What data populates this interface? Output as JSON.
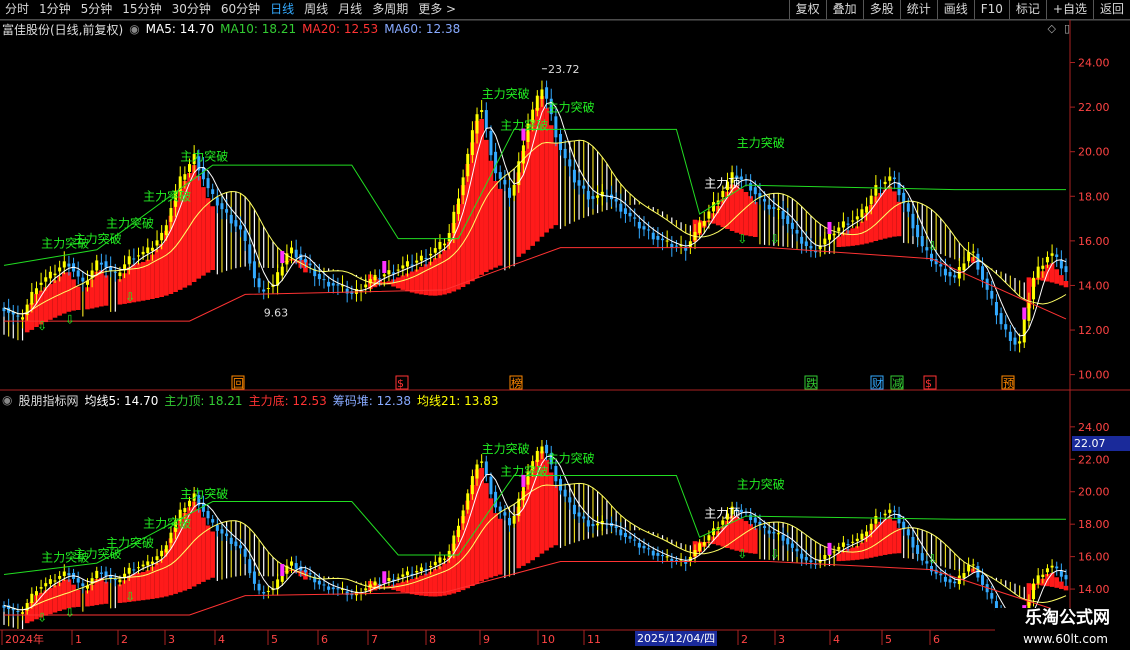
{
  "toolbar": {
    "periods": [
      "分时",
      "1分钟",
      "5分钟",
      "15分钟",
      "30分钟",
      "60分钟",
      "日线",
      "周线",
      "月线",
      "多周期",
      "更多"
    ],
    "active_period": "日线",
    "more_arrow": ">",
    "right_buttons": [
      "复权",
      "叠加",
      "多股",
      "统计",
      "画线",
      "F10",
      "标记",
      "+自选",
      "返回"
    ]
  },
  "main_panel": {
    "title": "富佳股份(日线,前复权)",
    "indicators": [
      {
        "label": "MA5: 14.70",
        "color": "#ffffff"
      },
      {
        "label": "MA10: 18.21",
        "color": "#33cc33"
      },
      {
        "label": "MA20: 12.53",
        "color": "#ff3333"
      },
      {
        "label": "MA60: 12.38",
        "color": "#88aaff"
      }
    ],
    "high_label": "23.72",
    "low_label": "9.63",
    "y_ticks": [
      "24.00",
      "22.00",
      "20.00",
      "18.00",
      "16.00",
      "14.00",
      "12.00",
      "10.00"
    ],
    "signals": [
      "主力突破",
      "主力突破",
      "主力突破",
      "主力突破",
      "主力突破",
      "主力突破",
      "主力突破",
      "主力突破"
    ],
    "signal_top": "主力顶",
    "event_marks": [
      {
        "text": "回",
        "color": "#ff8800"
      },
      {
        "text": "$",
        "color": "#ff3333"
      },
      {
        "text": "榜",
        "color": "#ff8800"
      },
      {
        "text": "跌",
        "color": "#33cc33"
      },
      {
        "text": "财",
        "color": "#33aaff"
      },
      {
        "text": "减",
        "color": "#33cc33"
      },
      {
        "text": "$",
        "color": "#ff3333"
      },
      {
        "text": "预",
        "color": "#ff8800"
      }
    ]
  },
  "sub_panel": {
    "title": "股朋指标网",
    "indicators": [
      {
        "label": "均线5: 14.70",
        "color": "#ffffff"
      },
      {
        "label": "主力顶: 18.21",
        "color": "#33cc33"
      },
      {
        "label": "主力底: 12.53",
        "color": "#ff3333"
      },
      {
        "label": "筹码堆: 12.38",
        "color": "#88aaff"
      },
      {
        "label": "均线21: 13.83",
        "color": "#ffff00"
      }
    ],
    "y_ticks": [
      "24.00",
      "22.00",
      "20.00",
      "18.00",
      "16.00",
      "14.00",
      "12.00"
    ],
    "cursor_value": "22.07"
  },
  "x_axis": {
    "labels": [
      "2024年",
      "1",
      "2",
      "3",
      "4",
      "5",
      "6",
      "7",
      "8",
      "9",
      "10",
      "11",
      "1",
      "2",
      "3",
      "4",
      "5",
      "6"
    ],
    "cursor_date": "2025/12/04/四"
  },
  "watermark": {
    "line1": "乐淘公式网",
    "line2": "www.60lt.com"
  },
  "chart_data": [
    {
      "type": "line",
      "title": "富佳股份(日线,前复权)",
      "ylim": [
        9.5,
        25
      ],
      "max": 23.72,
      "min": 9.63,
      "x_ticks": [
        "2024年",
        "1",
        "2",
        "3",
        "4",
        "5",
        "6",
        "7",
        "8",
        "9",
        "10",
        "11",
        "1",
        "2",
        "3",
        "4",
        "5",
        "6"
      ],
      "series": [
        {
          "name": "MA5",
          "last": 14.7
        },
        {
          "name": "MA10",
          "last": 18.21
        },
        {
          "name": "MA20",
          "last": 12.53
        },
        {
          "name": "MA60",
          "last": 12.38
        }
      ],
      "price_path": [
        13.0,
        12.4,
        14.0,
        14.5,
        15.1,
        14.0,
        15.2,
        14.4,
        15.3,
        15.5,
        16.3,
        18.6,
        19.8,
        18.1,
        17.2,
        16.4,
        13.8,
        14.0,
        15.7,
        15.0,
        14.2,
        14.0,
        13.6,
        14.2,
        14.5,
        14.8,
        15.1,
        15.5,
        16.1,
        19.0,
        22.3,
        19.1,
        17.9,
        21.2,
        23.0,
        20.3,
        18.7,
        17.9,
        18.1,
        17.4,
        16.7,
        16.2,
        15.8,
        15.7,
        16.8,
        17.9,
        19.0,
        18.5,
        17.6,
        17.3,
        16.2,
        15.5,
        16.2,
        16.8,
        17.1,
        18.4,
        18.9,
        17.3,
        15.6,
        14.8,
        14.3,
        15.7,
        13.8,
        12.1,
        11.2,
        14.5,
        15.5,
        14.6
      ]
    }
  ]
}
